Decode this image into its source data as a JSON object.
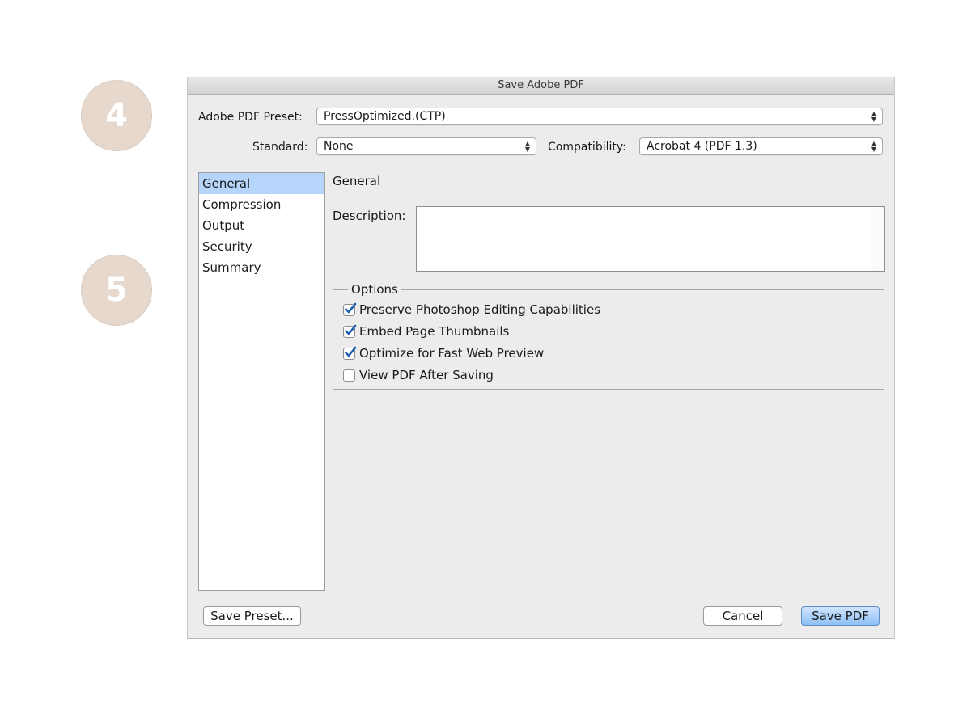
{
  "callouts": {
    "preset_number": "4",
    "options_number": "5"
  },
  "dialog": {
    "title": "Save Adobe PDF",
    "preset": {
      "label": "Adobe PDF Preset:",
      "value": "PressOptimized.(CTP)"
    },
    "standard": {
      "label": "Standard:",
      "value": "None"
    },
    "compatibility": {
      "label": "Compatibility:",
      "value": "Acrobat 4 (PDF 1.3)"
    },
    "sidebar": {
      "items": [
        {
          "label": "General",
          "selected": true
        },
        {
          "label": "Compression",
          "selected": false
        },
        {
          "label": "Output",
          "selected": false
        },
        {
          "label": "Security",
          "selected": false
        },
        {
          "label": "Summary",
          "selected": false
        }
      ]
    },
    "general": {
      "title": "General",
      "description_label": "Description:",
      "description_value": ""
    },
    "options": {
      "legend": "Options",
      "items": [
        {
          "label": "Preserve Photoshop Editing Capabilities",
          "checked": true
        },
        {
          "label": "Embed Page Thumbnails",
          "checked": true
        },
        {
          "label": "Optimize for Fast Web Preview",
          "checked": true
        },
        {
          "label": "View PDF After Saving",
          "checked": false
        }
      ]
    },
    "buttons": {
      "save_preset": "Save Preset...",
      "cancel": "Cancel",
      "save_pdf": "Save PDF"
    }
  },
  "colors": {
    "selected_row": "#b5d5fb",
    "default_button": "#8ec0f5",
    "callout": "#e6d8cd",
    "checkmark": "#1d5fae"
  }
}
